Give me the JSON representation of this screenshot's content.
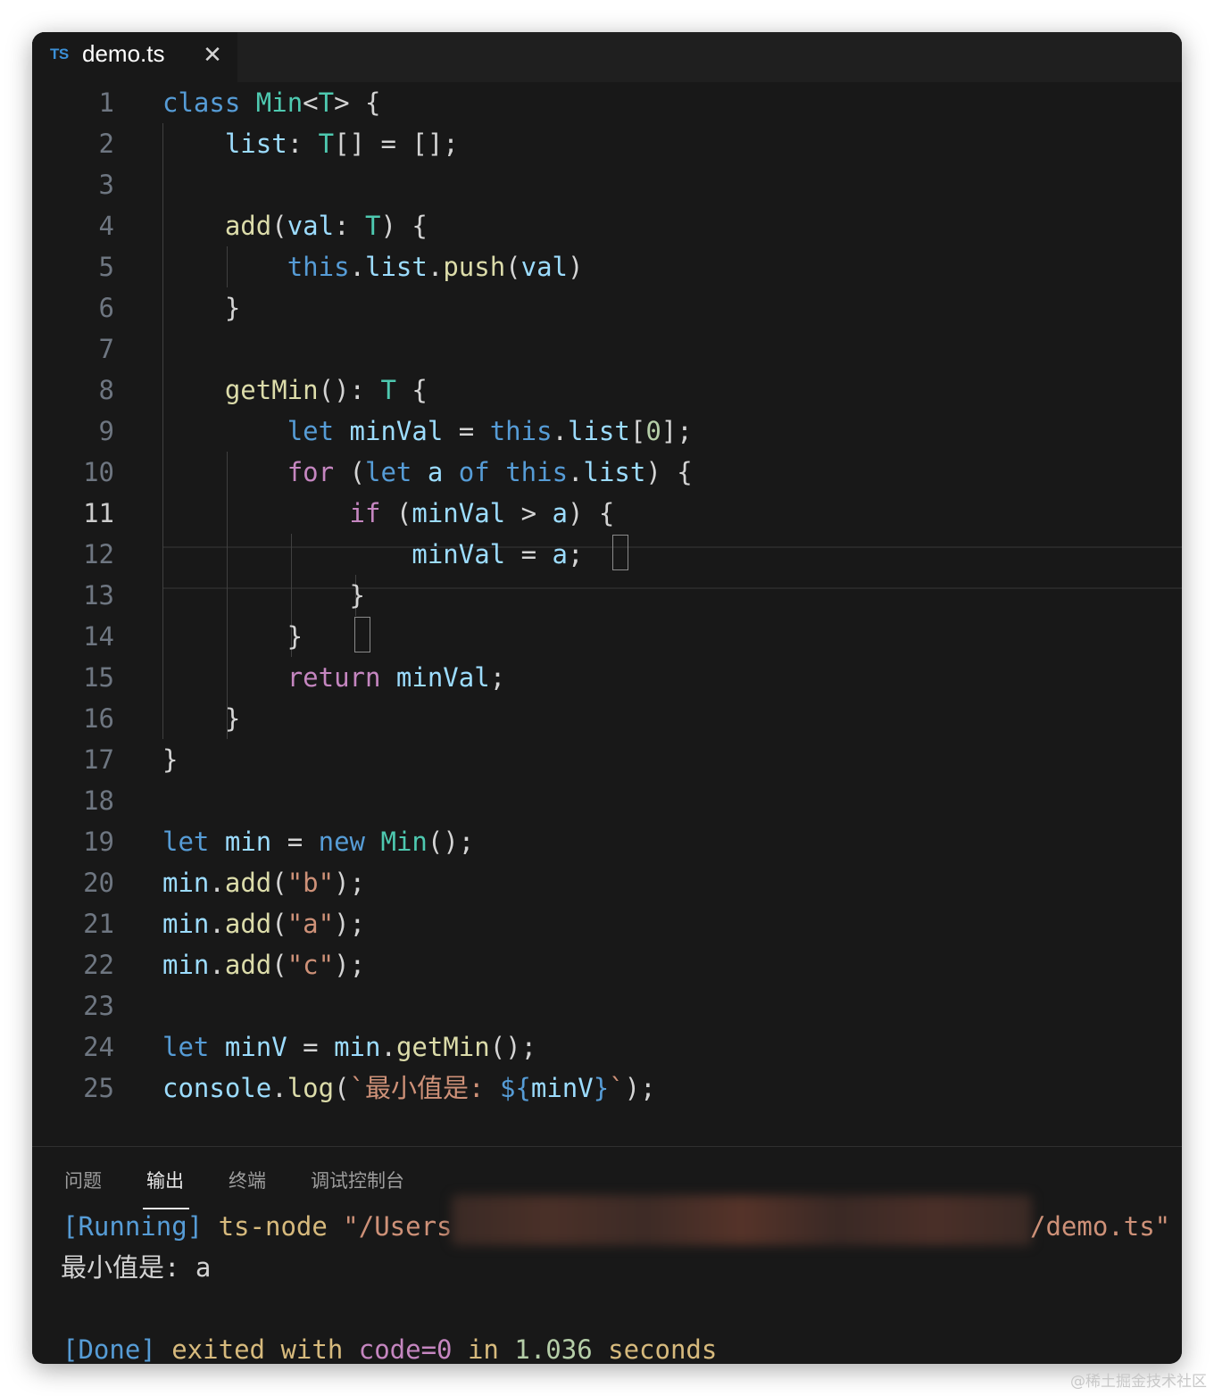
{
  "tab": {
    "icon_text": "TS",
    "icon": "typescript-file-icon",
    "title": "demo.ts",
    "close_icon": "close-icon"
  },
  "editor": {
    "active_line": 11,
    "lines": [
      {
        "n": "1",
        "tokens": [
          [
            "kw",
            "class"
          ],
          [
            "pun",
            " "
          ],
          [
            "ty",
            "Min"
          ],
          [
            "pun",
            "<"
          ],
          [
            "ty",
            "T"
          ],
          [
            "pun",
            "> {"
          ]
        ]
      },
      {
        "n": "2",
        "tokens": [
          [
            "pun",
            "    "
          ],
          [
            "var",
            "list"
          ],
          [
            "pun",
            ": "
          ],
          [
            "ty",
            "T"
          ],
          [
            "pun",
            "[] = [];"
          ]
        ]
      },
      {
        "n": "3",
        "tokens": []
      },
      {
        "n": "4",
        "tokens": [
          [
            "pun",
            "    "
          ],
          [
            "fn",
            "add"
          ],
          [
            "pun",
            "("
          ],
          [
            "var",
            "val"
          ],
          [
            "pun",
            ": "
          ],
          [
            "ty",
            "T"
          ],
          [
            "pun",
            ") {"
          ]
        ]
      },
      {
        "n": "5",
        "tokens": [
          [
            "pun",
            "        "
          ],
          [
            "kw",
            "this"
          ],
          [
            "pun",
            "."
          ],
          [
            "var",
            "list"
          ],
          [
            "pun",
            "."
          ],
          [
            "fn",
            "push"
          ],
          [
            "pun",
            "("
          ],
          [
            "var",
            "val"
          ],
          [
            "pun",
            ")"
          ]
        ]
      },
      {
        "n": "6",
        "tokens": [
          [
            "pun",
            "    }"
          ]
        ]
      },
      {
        "n": "7",
        "tokens": []
      },
      {
        "n": "8",
        "tokens": [
          [
            "pun",
            "    "
          ],
          [
            "fn",
            "getMin"
          ],
          [
            "pun",
            "(): "
          ],
          [
            "ty",
            "T"
          ],
          [
            "pun",
            " {"
          ]
        ]
      },
      {
        "n": "9",
        "tokens": [
          [
            "pun",
            "        "
          ],
          [
            "kw",
            "let"
          ],
          [
            "pun",
            " "
          ],
          [
            "var",
            "minVal"
          ],
          [
            "pun",
            " = "
          ],
          [
            "kw",
            "this"
          ],
          [
            "pun",
            "."
          ],
          [
            "var",
            "list"
          ],
          [
            "pun",
            "["
          ],
          [
            "num",
            "0"
          ],
          [
            "pun",
            "];"
          ]
        ]
      },
      {
        "n": "10",
        "tokens": [
          [
            "pun",
            "        "
          ],
          [
            "ctl",
            "for"
          ],
          [
            "pun",
            " ("
          ],
          [
            "kw",
            "let"
          ],
          [
            "pun",
            " "
          ],
          [
            "var",
            "a"
          ],
          [
            "pun",
            " "
          ],
          [
            "kw",
            "of"
          ],
          [
            "pun",
            " "
          ],
          [
            "kw",
            "this"
          ],
          [
            "pun",
            "."
          ],
          [
            "var",
            "list"
          ],
          [
            "pun",
            ") {"
          ]
        ]
      },
      {
        "n": "11",
        "tokens": [
          [
            "pun",
            "            "
          ],
          [
            "ctl",
            "if"
          ],
          [
            "pun",
            " ("
          ],
          [
            "var",
            "minVal"
          ],
          [
            "pun",
            " > "
          ],
          [
            "var",
            "a"
          ],
          [
            "pun",
            ") {"
          ]
        ]
      },
      {
        "n": "12",
        "tokens": [
          [
            "pun",
            "                "
          ],
          [
            "var",
            "minVal"
          ],
          [
            "pun",
            " = "
          ],
          [
            "var",
            "a"
          ],
          [
            "pun",
            ";"
          ]
        ]
      },
      {
        "n": "13",
        "tokens": [
          [
            "pun",
            "            }"
          ]
        ]
      },
      {
        "n": "14",
        "tokens": [
          [
            "pun",
            "        }"
          ]
        ]
      },
      {
        "n": "15",
        "tokens": [
          [
            "pun",
            "        "
          ],
          [
            "ctl",
            "return"
          ],
          [
            "pun",
            " "
          ],
          [
            "var",
            "minVal"
          ],
          [
            "pun",
            ";"
          ]
        ]
      },
      {
        "n": "16",
        "tokens": [
          [
            "pun",
            "    }"
          ]
        ]
      },
      {
        "n": "17",
        "tokens": [
          [
            "pun",
            "}"
          ]
        ]
      },
      {
        "n": "18",
        "tokens": []
      },
      {
        "n": "19",
        "tokens": [
          [
            "kw",
            "let"
          ],
          [
            "pun",
            " "
          ],
          [
            "var",
            "min"
          ],
          [
            "pun",
            " = "
          ],
          [
            "kw",
            "new"
          ],
          [
            "pun",
            " "
          ],
          [
            "ty",
            "Min"
          ],
          [
            "pun",
            "();"
          ]
        ]
      },
      {
        "n": "20",
        "tokens": [
          [
            "var",
            "min"
          ],
          [
            "pun",
            "."
          ],
          [
            "fn",
            "add"
          ],
          [
            "pun",
            "("
          ],
          [
            "str",
            "\"b\""
          ],
          [
            "pun",
            ");"
          ]
        ]
      },
      {
        "n": "21",
        "tokens": [
          [
            "var",
            "min"
          ],
          [
            "pun",
            "."
          ],
          [
            "fn",
            "add"
          ],
          [
            "pun",
            "("
          ],
          [
            "str",
            "\"a\""
          ],
          [
            "pun",
            ");"
          ]
        ]
      },
      {
        "n": "22",
        "tokens": [
          [
            "var",
            "min"
          ],
          [
            "pun",
            "."
          ],
          [
            "fn",
            "add"
          ],
          [
            "pun",
            "("
          ],
          [
            "str",
            "\"c\""
          ],
          [
            "pun",
            ");"
          ]
        ]
      },
      {
        "n": "23",
        "tokens": []
      },
      {
        "n": "24",
        "tokens": [
          [
            "kw",
            "let"
          ],
          [
            "pun",
            " "
          ],
          [
            "var",
            "minV"
          ],
          [
            "pun",
            " = "
          ],
          [
            "var",
            "min"
          ],
          [
            "pun",
            "."
          ],
          [
            "fn",
            "getMin"
          ],
          [
            "pun",
            "();"
          ]
        ]
      },
      {
        "n": "25",
        "tokens": [
          [
            "var",
            "console"
          ],
          [
            "pun",
            "."
          ],
          [
            "fn",
            "log"
          ],
          [
            "pun",
            "("
          ],
          [
            "str",
            "`最小值是: "
          ],
          [
            "kw",
            "${"
          ],
          [
            "var",
            "minV"
          ],
          [
            "kw",
            "}"
          ],
          [
            "str",
            "`"
          ],
          [
            "pun",
            ");"
          ]
        ]
      }
    ]
  },
  "panel": {
    "tabs": [
      "问题",
      "输出",
      "终端",
      "调试控制台"
    ],
    "active_tab": "输出",
    "output": {
      "run_tag": "[Running]",
      "run_cmd": " ts-node ",
      "run_path_start": "\"/Users",
      "run_path_end": "/demo.ts\"",
      "result": "最小值是: a",
      "done_tag": "[Done]",
      "done_text": " exited with ",
      "done_code": "code=0",
      "done_in": " in ",
      "done_time": "1.036",
      "done_unit": " seconds"
    }
  },
  "watermark": "@稀土掘金技术社区"
}
